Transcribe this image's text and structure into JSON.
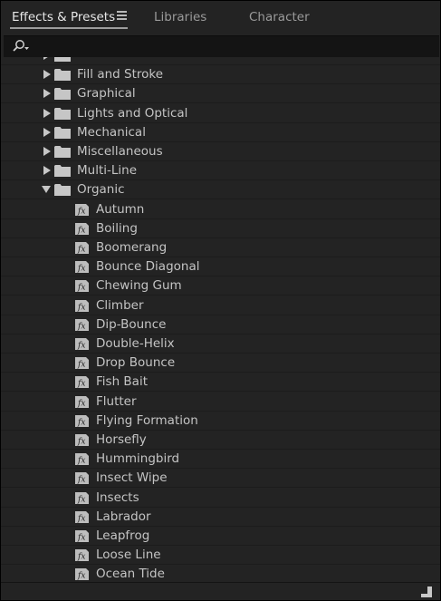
{
  "tabs": [
    {
      "label": "Effects & Presets"
    },
    {
      "label": "Libraries"
    },
    {
      "label": "Character"
    }
  ],
  "search": {
    "value": "",
    "placeholder": ""
  },
  "tree": {
    "partial_label": "",
    "folders": [
      {
        "label": "Fill and Stroke",
        "expanded": false
      },
      {
        "label": "Graphical",
        "expanded": false
      },
      {
        "label": "Lights and Optical",
        "expanded": false
      },
      {
        "label": "Mechanical",
        "expanded": false
      },
      {
        "label": "Miscellaneous",
        "expanded": false
      },
      {
        "label": "Multi-Line",
        "expanded": false
      },
      {
        "label": "Organic",
        "expanded": true
      }
    ],
    "presets": [
      "Autumn",
      "Boiling",
      "Boomerang",
      "Bounce Diagonal",
      "Chewing Gum",
      "Climber",
      "Dip-Bounce",
      "Double-Helix",
      "Drop Bounce",
      "Fish Bait",
      "Flutter",
      "Flying Formation",
      "Horsefly",
      "Hummingbird",
      "Insect Wipe",
      "Insects",
      "Labrador",
      "Leapfrog",
      "Loose Line",
      "Ocean Tide"
    ]
  },
  "icons": {
    "menu": "hamburger-menu-icon",
    "search": "search-icon",
    "folder": "folder-icon",
    "preset": "fx-preset-icon",
    "collapsed": "triangle-right-icon",
    "expanded": "triangle-down-icon",
    "new_bin": "new-bin-icon"
  },
  "colors": {
    "panel_bg": "#232323",
    "search_bg": "#141414",
    "text": "#c4c4c4",
    "active_tab": "#e6e6e6",
    "inactive_tab": "#9a9a9a"
  }
}
